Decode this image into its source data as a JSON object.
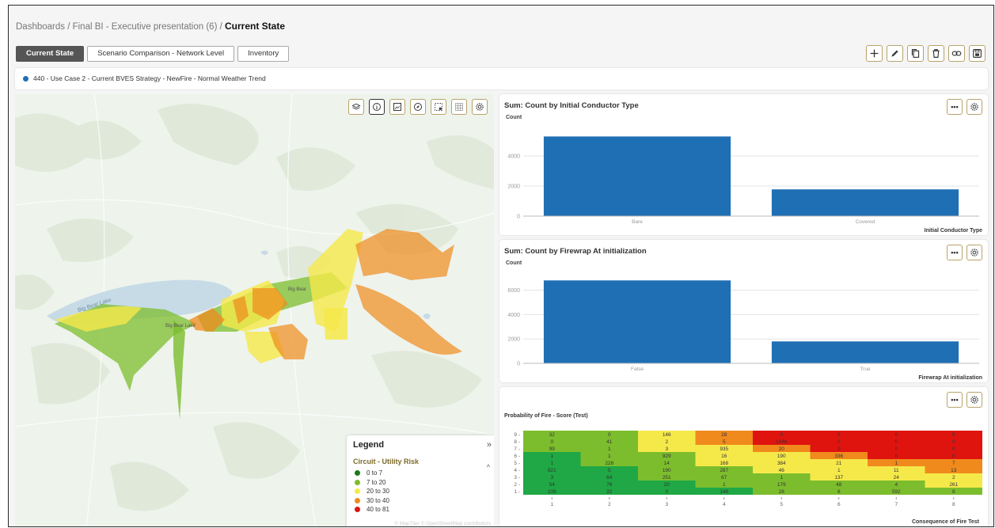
{
  "breadcrumb": {
    "prefix": "Dashboards / Final BI - Executive presentation (6) / ",
    "current": "Current State"
  },
  "tabs": [
    {
      "label": "Current State"
    },
    {
      "label": "Scenario Comparison - Network Level"
    },
    {
      "label": "Inventory"
    }
  ],
  "toolbar": [
    "add-icon",
    "edit-icon",
    "copy-icon",
    "delete-icon",
    "link-icon",
    "save-icon"
  ],
  "scenario": {
    "label": "440 - Use Case 2 - Current BVES Strategy - NewFire - Normal Weather Trend",
    "color": "#1f6fb4"
  },
  "map": {
    "place_labels": [
      "Big Bear Lake",
      "Big Bear Lake",
      "Big Bear"
    ],
    "tools": [
      "layers-icon",
      "info-icon",
      "image-icon",
      "compass-icon",
      "select-icon",
      "grid-icon",
      "settings-icon"
    ],
    "legend": {
      "title": "Legend",
      "subtitle": "Circuit - Utility Risk",
      "expand": "»",
      "collapse": "^",
      "items": [
        {
          "label": "0 to 7",
          "color": "#1a7a1a"
        },
        {
          "label": "7 to 20",
          "color": "#7cbd2d"
        },
        {
          "label": "20 to 30",
          "color": "#f5e94a"
        },
        {
          "label": "30 to 40",
          "color": "#f08a1c"
        },
        {
          "label": "40 to 81",
          "color": "#e0140f"
        }
      ]
    },
    "attribution": "© MapTiler © OpenStreetMap contributors"
  },
  "panel_more": "•••",
  "chart_data": [
    {
      "type": "bar",
      "title": "Sum: Count by Initial Conductor Type",
      "ylabel": "Count",
      "xlabel": "Initial Conductor Type",
      "categories": [
        "Bare",
        "Covered"
      ],
      "values": [
        5300,
        1780
      ],
      "yticks": [
        0,
        2000,
        4000
      ],
      "ylim": [
        0,
        5900
      ],
      "color": "#1f6fb4"
    },
    {
      "type": "bar",
      "title": "Sum: Count by Firewrap At initialization",
      "ylabel": "Count",
      "xlabel": "Firewrap At initialization",
      "categories": [
        "False",
        "True"
      ],
      "values": [
        6800,
        1800
      ],
      "yticks": [
        0,
        2000,
        4000,
        6000
      ],
      "ylim": [
        0,
        7400
      ],
      "color": "#1f6fb4"
    },
    {
      "type": "heatmap",
      "title": "Probability of Fire - Score (Test)",
      "xlabel": "Consequence of Fire Test",
      "x": [
        "1",
        "2",
        "3",
        "4",
        "5",
        "6",
        "7",
        "8"
      ],
      "y": [
        "9",
        "8",
        "7",
        "6",
        "5",
        "4",
        "3",
        "2",
        "1"
      ],
      "values": [
        [
          32,
          0,
          146,
          28,
          0,
          5,
          0,
          0
        ],
        [
          0,
          41,
          2,
          5,
          1046,
          0,
          0,
          0
        ],
        [
          99,
          1,
          3,
          935,
          20,
          0,
          0,
          0
        ],
        [
          1,
          1,
          929,
          16,
          190,
          336,
          0,
          0
        ],
        [
          1,
          228,
          14,
          168,
          384,
          21,
          1,
          7
        ],
        [
          921,
          5,
          190,
          287,
          46,
          1,
          11,
          13
        ],
        [
          3,
          64,
          251,
          67,
          1,
          137,
          24,
          2
        ],
        [
          54,
          76,
          20,
          1,
          179,
          48,
          4,
          261
        ],
        [
          109,
          32,
          0,
          146,
          28,
          6,
          592,
          8
        ]
      ],
      "colors": [
        [
          "#7cbd2d",
          "#7cbd2d",
          "#f5e94a",
          "#f08a1c",
          "#e0140f",
          "#e0140f",
          "#e0140f",
          "#e0140f"
        ],
        [
          "#7cbd2d",
          "#7cbd2d",
          "#f5e94a",
          "#f08a1c",
          "#e0140f",
          "#e0140f",
          "#e0140f",
          "#e0140f"
        ],
        [
          "#7cbd2d",
          "#7cbd2d",
          "#f5e94a",
          "#f5e94a",
          "#f08a1c",
          "#e0140f",
          "#e0140f",
          "#e0140f"
        ],
        [
          "#1fa845",
          "#7cbd2d",
          "#7cbd2d",
          "#f5e94a",
          "#f5e94a",
          "#f08a1c",
          "#e0140f",
          "#e0140f"
        ],
        [
          "#1fa845",
          "#7cbd2d",
          "#7cbd2d",
          "#f5e94a",
          "#f5e94a",
          "#f5e94a",
          "#f08a1c",
          "#f08a1c"
        ],
        [
          "#1fa845",
          "#1fa845",
          "#7cbd2d",
          "#7cbd2d",
          "#f5e94a",
          "#f5e94a",
          "#f5e94a",
          "#f08a1c"
        ],
        [
          "#1fa845",
          "#1fa845",
          "#7cbd2d",
          "#7cbd2d",
          "#7cbd2d",
          "#f5e94a",
          "#f5e94a",
          "#f5e94a"
        ],
        [
          "#1fa845",
          "#1fa845",
          "#1fa845",
          "#7cbd2d",
          "#7cbd2d",
          "#7cbd2d",
          "#7cbd2d",
          "#f5e94a"
        ],
        [
          "#1fa845",
          "#1fa845",
          "#1fa845",
          "#1fa845",
          "#7cbd2d",
          "#7cbd2d",
          "#7cbd2d",
          "#7cbd2d"
        ]
      ]
    }
  ]
}
